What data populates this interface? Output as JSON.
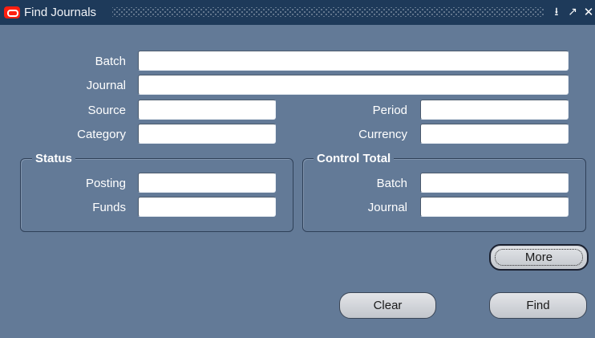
{
  "window": {
    "title": "Find Journals",
    "logo_icon": "oracle-logo-icon",
    "controls": {
      "minimize_icon": "minimize-icon",
      "maximize_icon": "maximize-icon",
      "close_icon": "close-icon"
    }
  },
  "form": {
    "batch_label": "Batch",
    "journal_label": "Journal",
    "source_label": "Source",
    "category_label": "Category",
    "period_label": "Period",
    "currency_label": "Currency",
    "batch_value": "",
    "journal_value": "",
    "source_value": "",
    "category_value": "",
    "period_value": "",
    "currency_value": ""
  },
  "status": {
    "title": "Status",
    "posting_label": "Posting",
    "funds_label": "Funds",
    "posting_value": "",
    "funds_value": ""
  },
  "control_total": {
    "title": "Control Total",
    "batch_label": "Batch",
    "journal_label": "Journal",
    "batch_value": "",
    "journal_value": ""
  },
  "buttons": {
    "more": "More",
    "clear": "Clear",
    "find": "Find"
  },
  "colors": {
    "background": "#637a97",
    "titlebar": "#1e3a5a",
    "logo_red": "#ff1f10"
  }
}
